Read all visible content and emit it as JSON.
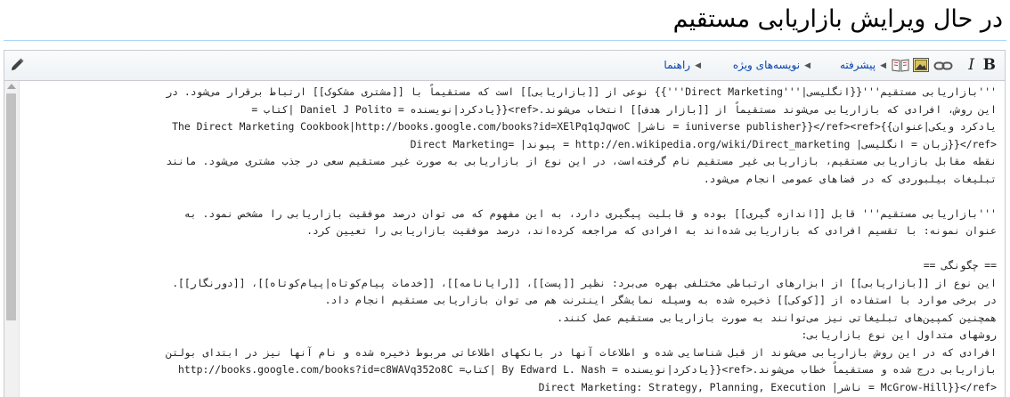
{
  "page": {
    "title": "در حال ویرایش بازاریابی مستقیم"
  },
  "toolbar": {
    "bold_label": "B",
    "italic_label": "I",
    "groups": {
      "advanced": "پیشرفته",
      "special_chars": "نویسه‌های ویژه",
      "help": "راهنما"
    },
    "icons": [
      "pencil-icon",
      "bold-icon",
      "italic-icon",
      "link-icon",
      "embedded-image-icon",
      "reference-book-icon",
      "arrow-icon"
    ]
  },
  "editor": {
    "lines": [
      "'''بازاریابی مستقیم'''{{انگلیسی|'''Direct Marketing'''}} نوعی از [[بازاریابی]] است که مستقیماً با [[مشتری مشکوک]] ارتباط برقرار می‌شود. در",
      "این روش، افرادی که بازاریابی می‌شوند مستقیماً از [[بازار هدف]] انتخاب می‌شوند.<ref>{{یادکرد|نویسنده = Daniel J Polito |کتاب =",
      "The Direct Marketing Cookbook|http://books.google.com/books?id=XElPq1qJqwoC |ناشر = iuniverse publisher}}</ref><ref>{{یادکرد ویکی|عنوان",
      "Direct Marketing= |پیوند = http://en.wikipedia.org/wiki/Direct_marketing |زبان = انگلیسی}}</ref>",
      "نقطه مقابل بازاریابی مستقیم، بازاریابی غیر مستقیم نام گرفته‌است، در این نوع از بازاریابی به صورت غیر مستقیم سعی در جذب مشتری می‌شود. مانند",
      "تبلیغات بیلبوردی که در فضاهای عمومی انجام می‌شود.",
      "",
      "'''بازاریابی مستقیم''' قابل [[اندازه گیری]] بوده و قابلیت پیگیری دارد، به این مفهوم که می توان درصد موفقیت بازاریابی را مشخص نمود. به",
      "عنوان نمونه: با تقسیم افرادی که بازاریابی شده‌اند به افرادی که مراجعه کرده‌اند، درصد موفقیت بازاریابی را تعیین کرد.",
      "",
      "== چگونگی ==",
      "این نوع از [[بازاریابی]] از ابزارهای ارتباطی مختلفی بهره می‌برد: نظیر [[پست]]، [[رایانامه]]، [[خدمات پیام‌کوتاه|پیام‌کوتاه]]، [[دورنگار]].",
      "در برخی موارد با استفاده از [[کوکی]] ذخیره شده به وسیله نمایشگر اینترنت هم می توان بازاریابی مستقیم انجام داد.",
      "همچنین کمپین‌های تبلیغاتی نیز می‌توانند به صورت بازاریابی مستقیم عمل کنند.",
      "روشهای متداول این نوع بازاریابی:",
      "افرادی که در این روش بازاریابی می‌شوند از قبل شناسایی شده و اطلاعات آنها در بانکهای اطلاعاتی مربوط ذخیره شده و نام آنها نیز در ابتدای بولتن",
      "بازاریابی درج شده و مستقیماً خطاب می‌شوند.<ref>{{یادکرد|نویسنده = By Edward L. Nash |کتاب= http://books.google.com/books?id=c8WAVq352o8C",
      "Direct Marketing: Strategy, Planning, Execution |ناشر = McGrow-Hill}}</ref>"
    ]
  }
}
